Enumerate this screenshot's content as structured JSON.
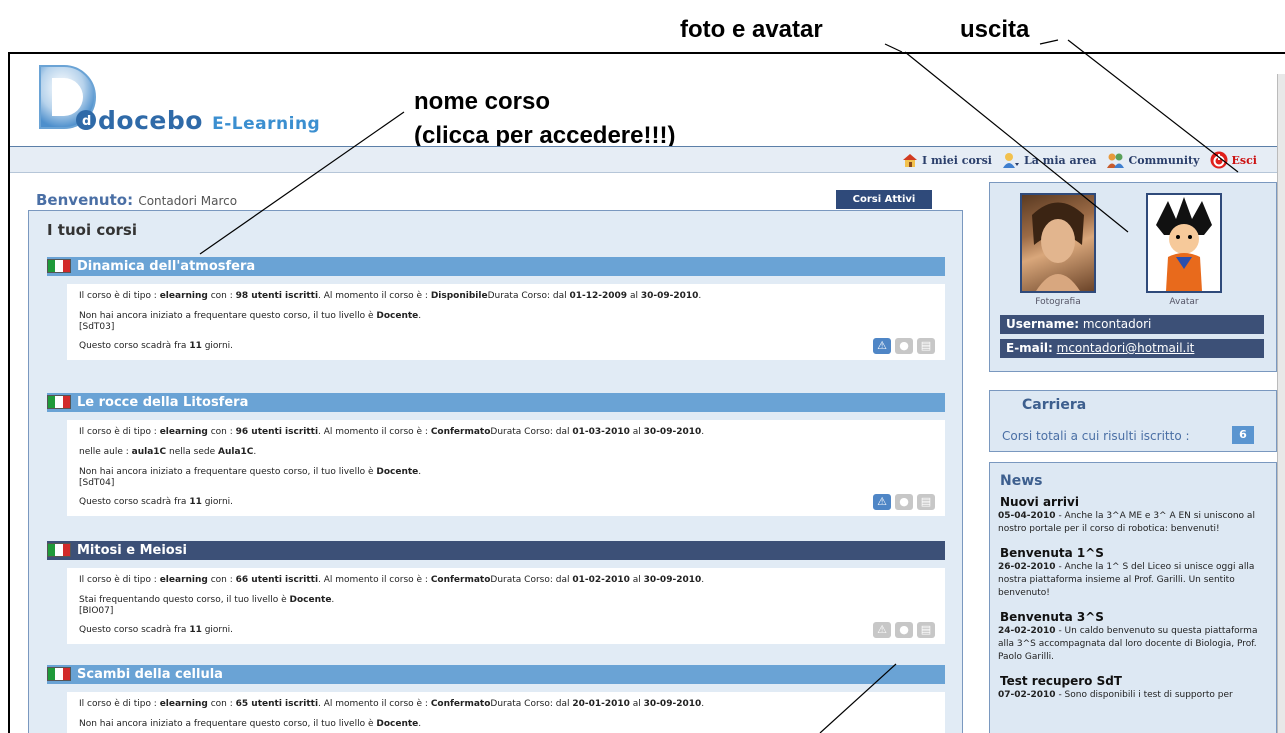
{
  "annotations": {
    "photo_avatar": "foto e avatar",
    "logout": "uscita",
    "course_name_1": "nome corso",
    "course_name_2": "(clicca per accedere!!!)"
  },
  "header": {
    "brand": "docebo",
    "brand_sub": "E-Learning"
  },
  "nav": {
    "my_courses": "I miei corsi",
    "my_area": "La mia area",
    "community": "Community",
    "logout": "Esci"
  },
  "welcome": {
    "label": "Benvenuto:",
    "name": "Contadori Marco"
  },
  "active_tab": "Corsi Attivi",
  "courses_title": "I tuoi corsi",
  "courses": [
    {
      "title": "Dinamica dell'atmosfera",
      "dark": false,
      "info_pre": "Il corso è di tipo : ",
      "type": "elearning",
      "info_mid": " con : ",
      "users": "98 utenti iscritti",
      "info_status_pre": ". Al momento il corso è : ",
      "status": "Disponibile",
      "duration_pre": "Durata Corso: dal ",
      "from": "01-12-2009",
      "duration_mid": " al ",
      "to": "30-09-2010",
      "rooms": "",
      "level_pre": "Non hai ancora iniziato a frequentare questo corso, il tuo livello è ",
      "level": "Docente",
      "code": "[SdT03]",
      "expire_pre": "Questo corso scadrà fra ",
      "expire_days": "11",
      "expire_post": " giorni.",
      "actions_on": true
    },
    {
      "title": "Le rocce della Litosfera",
      "dark": false,
      "info_pre": "Il corso è di tipo : ",
      "type": "elearning",
      "info_mid": " con : ",
      "users": "96 utenti iscritti",
      "info_status_pre": ". Al momento il corso è : ",
      "status": "Confermato",
      "duration_pre": "Durata Corso: dal ",
      "from": "01-03-2010",
      "duration_mid": " al ",
      "to": "30-09-2010",
      "rooms_pre": "nelle aule : ",
      "rooms_room": "aula1C",
      "rooms_mid": " nella sede ",
      "rooms_site": "Aula1C",
      "level_pre": "Non hai ancora iniziato a frequentare questo corso, il tuo livello è ",
      "level": "Docente",
      "code": "[SdT04]",
      "expire_pre": "Questo corso scadrà fra ",
      "expire_days": "11",
      "expire_post": " giorni.",
      "actions_on": true
    },
    {
      "title": "Mitosi e Meiosi",
      "dark": true,
      "info_pre": "Il corso è di tipo : ",
      "type": "elearning",
      "info_mid": " con : ",
      "users": "66 utenti iscritti",
      "info_status_pre": ". Al momento il corso è : ",
      "status": "Confermato",
      "duration_pre": "Durata Corso: dal ",
      "from": "01-02-2010",
      "duration_mid": " al ",
      "to": "30-09-2010",
      "level_pre": "Stai frequentando questo corso, il tuo livello è ",
      "level": "Docente",
      "code": "[BIO07]",
      "expire_pre": "Questo corso scadrà fra ",
      "expire_days": "11",
      "expire_post": " giorni.",
      "actions_on": false
    },
    {
      "title": "Scambi della cellula",
      "dark": false,
      "info_pre": "Il corso è di tipo : ",
      "type": "elearning",
      "info_mid": " con : ",
      "users": "65 utenti iscritti",
      "info_status_pre": ". Al momento il corso è : ",
      "status": "Confermato",
      "duration_pre": "Durata Corso: dal ",
      "from": "20-01-2010",
      "duration_mid": " al ",
      "to": "30-09-2010",
      "level_pre": "Non hai ancora iniziato a frequentare questo corso, il tuo livello è ",
      "level": "Docente"
    }
  ],
  "profile": {
    "photo_caption": "Fotografia",
    "avatar_caption": "Avatar",
    "username_label": "Username:",
    "username": "mcontadori",
    "email_label": "E-mail:",
    "email": "mcontadori@hotmail.it"
  },
  "career": {
    "title": "Carriera",
    "label": "Corsi totali a cui risulti iscritto :",
    "count": "6"
  },
  "news": {
    "title": "News",
    "items": [
      {
        "title": "Nuovi arrivi",
        "date": "05-04-2010",
        "text": " - Anche la 3^A ME e 3^ A EN si uniscono al nostro portale per il corso di robotica: benvenuti!"
      },
      {
        "title": "Benvenuta 1^S",
        "date": "26-02-2010",
        "text": " - Anche la 1^ S del Liceo si unisce oggi alla nostra piattaforma insieme al Prof. Garilli. Un sentito benvenuto!"
      },
      {
        "title": "Benvenuta 3^S",
        "date": "24-02-2010",
        "text": " - Un caldo benvenuto su questa piattaforma alla 3^S accompagnata dal loro docente di Biologia, Prof. Paolo Garilli."
      },
      {
        "title": "Test recupero SdT",
        "date": "07-02-2010",
        "text": " - Sono disponibili i test di supporto per"
      }
    ]
  },
  "colors": {
    "title_bar": "#6aa3d5",
    "title_bar_dark": "#3c5077",
    "accent": "#2f4a7a",
    "logout_red": "#cc1111"
  }
}
